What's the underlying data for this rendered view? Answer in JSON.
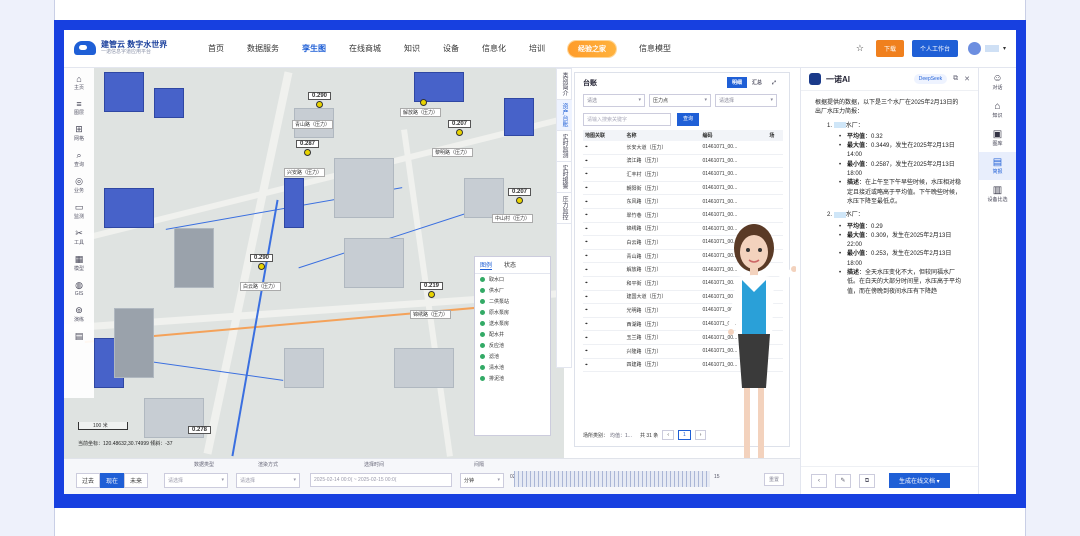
{
  "header": {
    "brand_title": "建管云  数字水世界",
    "brand_subtitle": "一诺信息字道应用平台",
    "nav": [
      "首页",
      "数据服务",
      "孪生图",
      "在线商城",
      "知识",
      "设备",
      "信息化",
      "培训"
    ],
    "active_nav": "孪生图",
    "badge": "经验之家",
    "nav_last": "信息模型",
    "download": "下载",
    "workspace": "个人工作台"
  },
  "map": {
    "tools": [
      {
        "icon": "home-icon",
        "glyph": "⌂",
        "label": "主页"
      },
      {
        "icon": "layer-icon",
        "glyph": "≡",
        "label": "图层"
      },
      {
        "icon": "grid-icon",
        "glyph": "⊞",
        "label": "网格"
      },
      {
        "icon": "query-icon",
        "glyph": "⌕",
        "label": "查询"
      },
      {
        "icon": "business-icon",
        "glyph": "◎",
        "label": "业务"
      },
      {
        "icon": "monitor-icon",
        "glyph": "▭",
        "label": "监测"
      },
      {
        "icon": "tool-icon",
        "glyph": "✂",
        "label": "工具"
      },
      {
        "icon": "model-icon",
        "glyph": "▦",
        "label": "模型"
      },
      {
        "icon": "gis-icon",
        "glyph": "◍",
        "label": "GIS"
      },
      {
        "icon": "drill-icon",
        "glyph": "⊚",
        "label": "演练"
      },
      {
        "icon": "trash-icon",
        "glyph": "▤",
        "label": ""
      }
    ],
    "pins": [
      {
        "value": "0.290",
        "label": "青山路（压力）"
      },
      {
        "value": "0.287",
        "label": "兴安路（压力）"
      },
      {
        "value": "",
        "label": "解放路（压力）"
      },
      {
        "value": "0.207",
        "label": "黎明路（压力）"
      },
      {
        "value": "0.207",
        "label": "中山村（压力）"
      },
      {
        "value": "0.290",
        "label": "白云路（压力）"
      },
      {
        "value": "0.219",
        "label": "锦绣路（压力）"
      },
      {
        "value": "0.278",
        "label": ""
      }
    ],
    "scale": "100 米",
    "coords": "当前坐标：120.48632,30.74999   倾斜：-37",
    "legend_tabs": [
      "图例",
      "状态"
    ],
    "legend_items": [
      "取水口",
      "供水厂",
      "二供泵站",
      "原水泵房",
      "送水泵房",
      "配水井",
      "反应池",
      "滤池",
      "清水池",
      "排泥池"
    ]
  },
  "side_tabs": [
    "类别简介",
    "资产台账",
    "实时监测",
    "实时报警",
    "压力监控"
  ],
  "table_panel": {
    "title": "台账",
    "tabs": [
      "明细",
      "汇总"
    ],
    "filter1": "请选",
    "filter2": "压力点",
    "filter3": "请选择",
    "search_placeholder": "请输入搜索关键字",
    "search_btn": "查询",
    "columns": [
      "地图关联",
      "名称",
      "编码",
      "场"
    ],
    "rows": [
      [
        "长安大道（压力）",
        "01461071_00..."
      ],
      [
        "滨江路（压力）",
        "01461071_00..."
      ],
      [
        "汇丰村（压力）",
        "01461071_00..."
      ],
      [
        "朝阳街（压力）",
        "01461071_00..."
      ],
      [
        "东风路（压力）",
        "01461071_00..."
      ],
      [
        "翠竹巷（压力）",
        "01461071_00..."
      ],
      [
        "锦绣路（压力）",
        "01461071_00..."
      ],
      [
        "白云路（压力）",
        "01461071_00..."
      ],
      [
        "青山路（压力）",
        "01461071_00..."
      ],
      [
        "解放路（压力）",
        "01461071_00..."
      ],
      [
        "和平街（压力）",
        "01461071_00..."
      ],
      [
        "建国大道（压力）",
        "01461071_00..."
      ],
      [
        "光明路（压力）",
        "01461071_00..."
      ],
      [
        "西湖路（压力）",
        "01461071_00..."
      ],
      [
        "玉兰路（压力）",
        "01461071_00..."
      ],
      [
        "兴隆路（压力）",
        "01461071_00..."
      ],
      [
        "四建路（压力）",
        "01461071_00..."
      ]
    ],
    "footer_label": "场所类别：",
    "footer_value": "均值：1...",
    "total": "共 31 条",
    "page": "1"
  },
  "bottom": {
    "label_datatype": "数据类型",
    "label_display": "渲染方式",
    "label_time": "选择时间",
    "label_interval": "间隔",
    "seg": [
      "过去",
      "现在",
      "未来"
    ],
    "select1": "请选择",
    "select2": "请选择",
    "date_range": "2025-02-14 00:0( ~ 2025-02-15 00:0(",
    "interval": "分钟",
    "tl_start": "02",
    "tl_end": "15",
    "reset": "重置"
  },
  "ai": {
    "title": "一诺AI",
    "model": "DeepSeek",
    "intro": "根据提供的数据，以下是三个水厂在2025年2月13日的出厂水压力简报：",
    "plants": [
      {
        "idx": "1.",
        "name_suffix": "水厂：",
        "items": [
          {
            "k": "平均值",
            "v": "：0.32"
          },
          {
            "k": "最大值",
            "v": "：0.3449，发生在2025年2月13日14:00"
          },
          {
            "k": "最小值",
            "v": "：0.2587，发生在2025年2月13日18:00"
          },
          {
            "k": "描述",
            "v": "：在上午至下午早些时候，水压相对稳定且接近或略高于平均值。下午晚些时候，水压下降至最低点。"
          }
        ]
      },
      {
        "idx": "2.",
        "name_suffix": "水厂：",
        "items": [
          {
            "k": "平均值",
            "v": "：0.29"
          },
          {
            "k": "最大值",
            "v": "：0.309，发生在2025年2月13日22:00"
          },
          {
            "k": "最小值",
            "v": "：0.253，发生在2025年2月13日18:00"
          },
          {
            "k": "描述",
            "v": "：全天水压变化不大，但较同福水厂低。在白天的大部分时间里，水压高于平均值，而在傍晚到夜间水压有下降趋"
          }
        ]
      }
    ],
    "generate_btn": "生成在线文档"
  },
  "rail": [
    {
      "icon": "chat-icon",
      "glyph": "☺",
      "label": "对话"
    },
    {
      "icon": "knowledge-icon",
      "glyph": "⌂",
      "label": "知识"
    },
    {
      "icon": "gallery-icon",
      "glyph": "▣",
      "label": "图库"
    },
    {
      "icon": "report-icon",
      "glyph": "▤",
      "label": "简报"
    },
    {
      "icon": "device-icon",
      "glyph": "▥",
      "label": "设备比选"
    }
  ]
}
